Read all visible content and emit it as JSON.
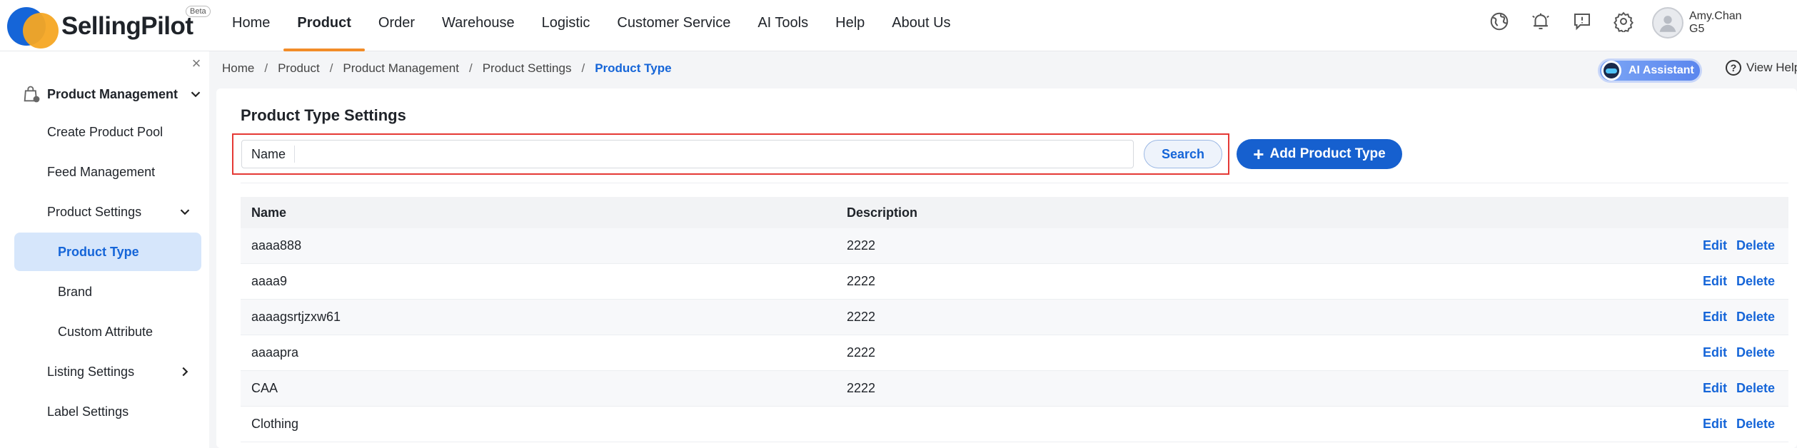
{
  "header": {
    "brand": "SellingPilot",
    "beta": "Beta",
    "nav": [
      {
        "label": "Home"
      },
      {
        "label": "Product",
        "active": true
      },
      {
        "label": "Order"
      },
      {
        "label": "Warehouse"
      },
      {
        "label": "Logistic"
      },
      {
        "label": "Customer Service"
      },
      {
        "label": "AI Tools"
      },
      {
        "label": "Help"
      },
      {
        "label": "About Us"
      }
    ],
    "icons": [
      "globe-icon",
      "bell-icon",
      "feedback-icon",
      "gear-icon"
    ],
    "user": {
      "name": "Amy.Chan",
      "sub": "G5"
    }
  },
  "sidebar": {
    "group": "Product Management",
    "items": [
      {
        "label": "Create Product Pool"
      },
      {
        "label": "Feed Management"
      },
      {
        "label": "Product Settings"
      },
      {
        "label": "Product Type"
      },
      {
        "label": "Brand"
      },
      {
        "label": "Custom Attribute"
      },
      {
        "label": "Listing Settings"
      },
      {
        "label": "Label Settings"
      }
    ]
  },
  "breadcrumb": [
    "Home",
    "Product",
    "Product Management",
    "Product Settings",
    "Product Type"
  ],
  "ai_assistant": "AI Assistant",
  "view_help": "View Help",
  "page_title": "Product Type Settings",
  "search": {
    "label": "Name",
    "value": "",
    "button": "Search"
  },
  "add_button": "Add Product Type",
  "table": {
    "columns": [
      "Name",
      "Description"
    ],
    "actions": {
      "edit": "Edit",
      "delete": "Delete"
    },
    "rows": [
      {
        "name": "aaaa888",
        "description": "2222"
      },
      {
        "name": "aaaa9",
        "description": "2222"
      },
      {
        "name": "aaaagsrtjzxw61",
        "description": "2222"
      },
      {
        "name": "aaaapra",
        "description": "2222"
      },
      {
        "name": "CAA",
        "description": "2222"
      },
      {
        "name": "Clothing",
        "description": ""
      }
    ]
  },
  "colors": {
    "accent": "#1565d8",
    "nav_active_underline": "#f28c28",
    "highlight": "#e53935"
  }
}
